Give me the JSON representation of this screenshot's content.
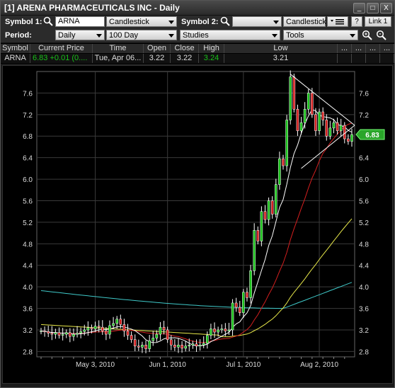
{
  "window": {
    "title": "[1] ARENA PHARMACEUTICALS INC - Daily",
    "buttons": [
      "_",
      "□",
      "X"
    ]
  },
  "toolbar": {
    "symbol1_label": "Symbol 1:",
    "symbol1_value": "ARNA",
    "chart_type1": "Candlestick",
    "symbol2_label": "Symbol 2:",
    "symbol2_value": "",
    "chart_type2": "Candlestick",
    "help_label": "?",
    "link_label": "Link 1",
    "period_label": "Period:",
    "period_value": "Daily",
    "range_value": "100 Day",
    "studies_value": "Studies",
    "tools_value": "Tools",
    "zoom_in_label": "+",
    "zoom_out_label": "-"
  },
  "quote": {
    "headers": [
      "Symbol",
      "Current Price",
      "Time",
      "Open",
      "Close",
      "High",
      "Low"
    ],
    "values": {
      "symbol": "ARNA",
      "price": "6.83",
      "change": "+0.01 (0....",
      "time": "Tue, Apr 06...",
      "open": "3.22",
      "close": "3.22",
      "high": "3.24",
      "low": "3.21"
    },
    "extra": [
      "...",
      "...",
      "...",
      "..."
    ]
  },
  "colors": {
    "up": "#19c219",
    "down": "#d41f1f",
    "ma_fast": "#ffffff",
    "ma_slow": "#d41f1f",
    "ma_200": "#e8e84a",
    "ma_long": "#3fc9c9",
    "price_tag": "#2aa52a"
  },
  "chart_data": {
    "type": "line",
    "ylim": [
      2.7,
      8.0
    ],
    "y_ticks": [
      "2.8",
      "3.2",
      "3.6",
      "4.0",
      "4.4",
      "4.8",
      "5.2",
      "5.6",
      "6.0",
      "6.4",
      "6.8",
      "7.2",
      "7.6"
    ],
    "x_tick_labels": [
      "May 3, 2010",
      "Jun 1, 2010",
      "Jul 1, 2010",
      "Aug 2, 2010"
    ],
    "last_price_label": "6.83",
    "series": [
      {
        "values": [
          3.18,
          3.17,
          3.14,
          3.12,
          3.15,
          3.1,
          3.12,
          3.15,
          3.08,
          3.12,
          3.14,
          3.17,
          3.2,
          3.24,
          3.22,
          3.27,
          3.25,
          3.18,
          3.12,
          3.28,
          3.32,
          3.4,
          3.3,
          3.18,
          3.1,
          3.02,
          2.9,
          2.88,
          2.92,
          2.85,
          3.0,
          3.05,
          3.12,
          3.25,
          3.2,
          3.02,
          2.92,
          2.88,
          2.92,
          2.86,
          2.9,
          2.92,
          2.94,
          2.9,
          2.92,
          2.95,
          3.1,
          3.22,
          3.16,
          3.2,
          3.22,
          3.18,
          3.2,
          3.7,
          3.62,
          3.52,
          3.9,
          3.8,
          4.3,
          5.05,
          4.85,
          5.4,
          5.25,
          5.6,
          5.35,
          5.9,
          6.38,
          6.25,
          7.1,
          7.9,
          7.3,
          6.9,
          7.05,
          7.3,
          7.6,
          7.2,
          6.9,
          7.25,
          7.1,
          6.8,
          6.95,
          7.05,
          6.9,
          7.0,
          6.75,
          6.7,
          6.83
        ]
      }
    ]
  }
}
